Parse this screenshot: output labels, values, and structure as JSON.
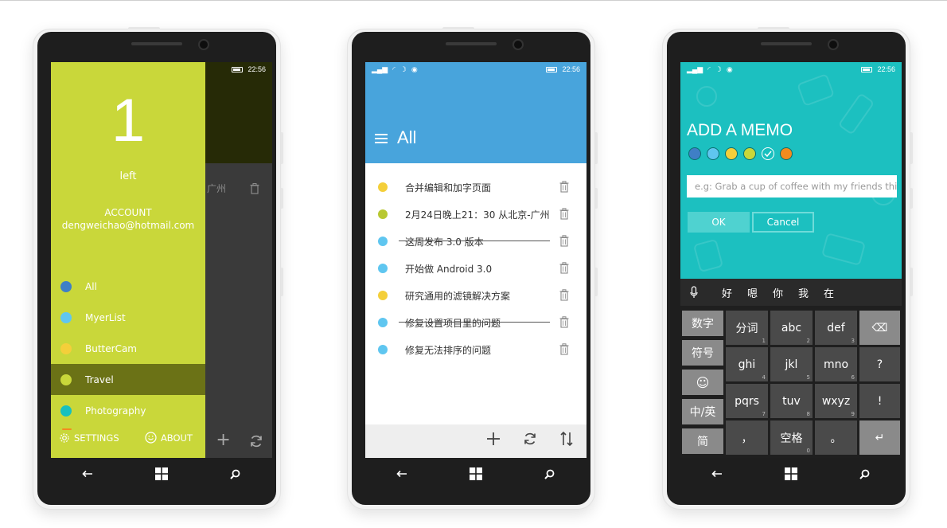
{
  "status": {
    "time": "22:56"
  },
  "phone1": {
    "count": "1",
    "count_label": "left",
    "account_label": "ACCOUNT",
    "email": "dengweichao@hotmail.com",
    "categories": [
      {
        "label": "All",
        "color": "#3f7fc6"
      },
      {
        "label": "MyerList",
        "color": "#5fc6f0"
      },
      {
        "label": "ButterCam",
        "color": "#f4cf3a"
      },
      {
        "label": "Travel",
        "color": "#c9d73a"
      },
      {
        "label": "Photography",
        "color": "#17c0bf"
      }
    ],
    "settings_label": "SETTINGS",
    "about_label": "ABOUT",
    "bg_row_text": "广州",
    "accent": "#c9d73a"
  },
  "phone2": {
    "title": "All",
    "header_color": "#48a4dc",
    "items": [
      {
        "text": "合并编辑和加字页面",
        "color": "#f4cf3a",
        "done": false
      },
      {
        "text": "2月24日晚上21：30 从北京-广州",
        "color": "#b8c832",
        "done": false
      },
      {
        "text": "这周发布 3.0 版本",
        "color": "#5fc6f0",
        "done": true
      },
      {
        "text": "开始做 Android 3.0",
        "color": "#5fc6f0",
        "done": false
      },
      {
        "text": "研究通用的滤镜解决方案",
        "color": "#f4cf3a",
        "done": false
      },
      {
        "text": "修复设置项目里的问题",
        "color": "#5fc6f0",
        "done": true
      },
      {
        "text": "修复无法排序的问题",
        "color": "#5fc6f0",
        "done": false
      }
    ]
  },
  "phone3": {
    "title": "ADD A MEMO",
    "swatches": [
      "#3f7fc6",
      "#5fc6f0",
      "#f4cf3a",
      "#c9d73a",
      "#17c0bf",
      "#f38b1f"
    ],
    "placeholder": "e.g: Grab a cup of coffee with my friends this",
    "ok_label": "OK",
    "cancel_label": "Cancel",
    "suggestions": [
      "好",
      "嗯",
      "你",
      "我",
      "在"
    ],
    "left_keys": [
      "数字",
      "符号",
      "☺",
      "中/英",
      "简"
    ],
    "keys": [
      {
        "main": "分词",
        "sub": "1"
      },
      {
        "main": "abc",
        "sub": "2"
      },
      {
        "main": "def",
        "sub": "3"
      },
      {
        "main": "ghi",
        "sub": "4"
      },
      {
        "main": "jkl",
        "sub": "5"
      },
      {
        "main": "mno",
        "sub": "6"
      },
      {
        "main": "pqrs",
        "sub": "7"
      },
      {
        "main": "tuv",
        "sub": "8"
      },
      {
        "main": "wxyz",
        "sub": "9"
      },
      {
        "main": "，",
        "sub": ""
      },
      {
        "main": "空格",
        "sub": "0"
      },
      {
        "main": "。",
        "sub": ""
      }
    ],
    "right_keys": [
      "⌫",
      "?",
      "!",
      "↵"
    ]
  }
}
